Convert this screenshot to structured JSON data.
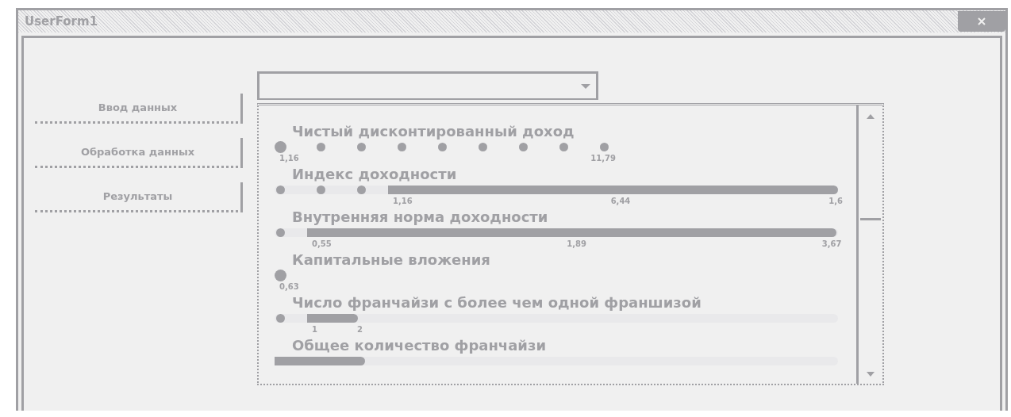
{
  "window": {
    "title": "UserForm1"
  },
  "buttons": [
    {
      "label": "Ввод данных"
    },
    {
      "label": "Обработка данных"
    },
    {
      "label": "Результаты"
    }
  ],
  "rows": [
    {
      "title": "Чистый дисконтированный доход",
      "markers": [
        {
          "kind": "big-dot"
        },
        {
          "kind": "dot"
        },
        {
          "kind": "dot"
        },
        {
          "kind": "dot"
        },
        {
          "kind": "dot"
        },
        {
          "kind": "dot"
        },
        {
          "kind": "dot"
        },
        {
          "kind": "dot"
        },
        {
          "kind": "dot"
        }
      ],
      "labels": [
        "1,16",
        "11,79"
      ]
    },
    {
      "title": "Индекс доходности",
      "markers": [
        {
          "kind": "dot"
        },
        {
          "kind": "dot"
        },
        {
          "kind": "dot"
        }
      ],
      "bar": {
        "level": 0.8
      },
      "labels": [
        "1,16",
        "6,44",
        "1,6"
      ]
    },
    {
      "title": "Внутренняя норма доходности",
      "markers": [
        {
          "kind": "dot"
        }
      ],
      "bar": {
        "level": 0.94
      },
      "labels": [
        "0,55",
        "1,89",
        "3,67"
      ]
    },
    {
      "title": "Капитальные вложения",
      "markers": [
        {
          "kind": "big-dot"
        }
      ],
      "labels": [
        "0,63"
      ]
    },
    {
      "title": "Число франчайзи с более чем одной франшизой",
      "markers": [
        {
          "kind": "dot"
        }
      ],
      "bar": {
        "level": 0.09
      },
      "labels": [
        "1",
        "2"
      ]
    },
    {
      "title": "Общее количество франчайзи",
      "markers": [],
      "bar": {
        "level": 0.16
      },
      "labels": []
    }
  ]
}
